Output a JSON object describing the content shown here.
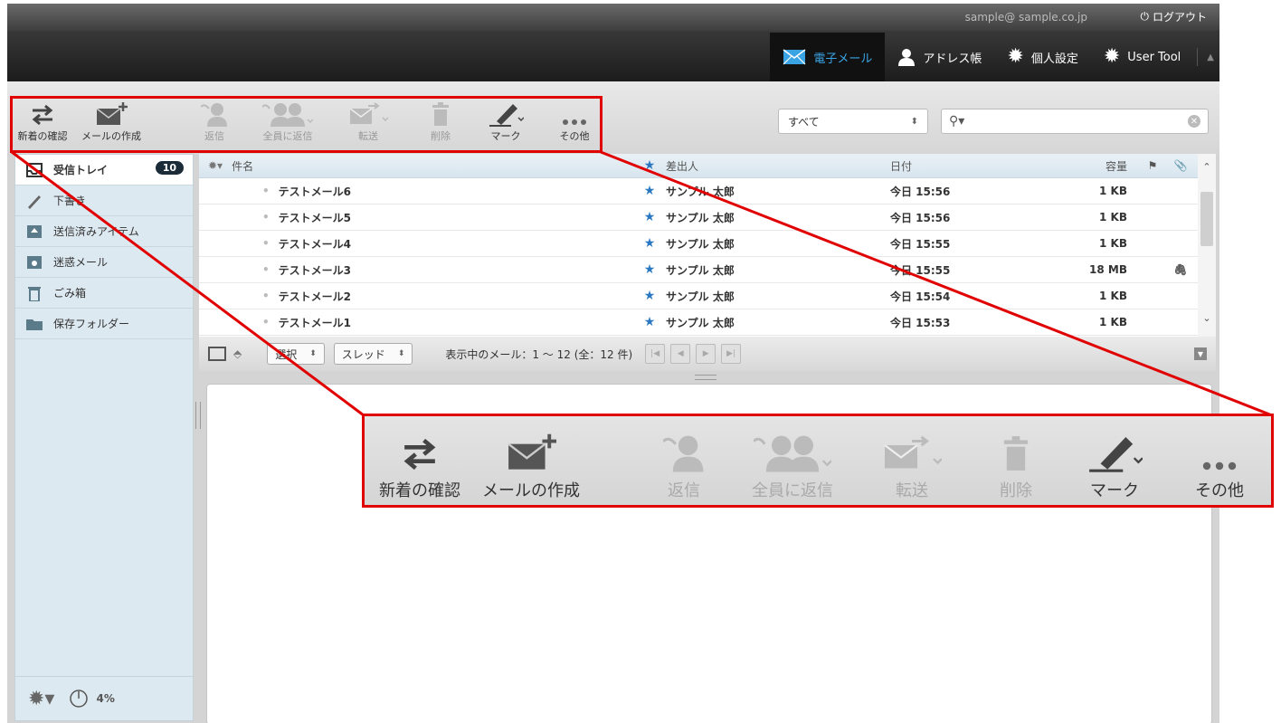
{
  "header": {
    "user_email": "sample@ sample.co.jp",
    "logout_label": "ログアウト",
    "nav": [
      {
        "label": "電子メール",
        "icon": "mail-icon",
        "active": true
      },
      {
        "label": "アドレス帳",
        "icon": "person-icon",
        "active": false
      },
      {
        "label": "個人設定",
        "icon": "gear-icon",
        "active": false
      },
      {
        "label": "User Tool",
        "icon": "user-tool-icon",
        "active": false
      }
    ]
  },
  "toolbar": {
    "buttons": [
      {
        "label": "新着の確認",
        "icon": "refresh-arrows-icon",
        "enabled": true
      },
      {
        "label": "メールの作成",
        "icon": "compose-mail-icon",
        "enabled": true
      },
      {
        "label": "返信",
        "icon": "reply-icon",
        "enabled": false
      },
      {
        "label": "全員に返信",
        "icon": "reply-all-icon",
        "enabled": false
      },
      {
        "label": "転送",
        "icon": "forward-icon",
        "enabled": false
      },
      {
        "label": "削除",
        "icon": "trash-icon",
        "enabled": false
      },
      {
        "label": "マーク",
        "icon": "mark-pen-icon",
        "enabled": true
      },
      {
        "label": "その他",
        "icon": "more-dots-icon",
        "enabled": true
      }
    ],
    "filter_value": "すべて",
    "search_placeholder": ""
  },
  "sidebar": {
    "folders": [
      {
        "label": "受信トレイ",
        "icon": "inbox-icon",
        "badge": "10",
        "active": true
      },
      {
        "label": "下書き",
        "icon": "pencil-icon",
        "badge": "",
        "active": false
      },
      {
        "label": "送信済みアイテム",
        "icon": "sent-icon",
        "badge": "",
        "active": false
      },
      {
        "label": "迷惑メール",
        "icon": "junk-icon",
        "badge": "",
        "active": false
      },
      {
        "label": "ごみ箱",
        "icon": "trash-icon",
        "badge": "",
        "active": false
      },
      {
        "label": "保存フォルダー",
        "icon": "folder-icon",
        "badge": "",
        "active": false
      }
    ],
    "quota": "4%"
  },
  "list": {
    "columns": {
      "subject": "件名",
      "from": "差出人",
      "date": "日付",
      "size": "容量"
    },
    "rows": [
      {
        "subject": "テストメール6",
        "from": "サンプル 太郎",
        "date": "今日 15:56",
        "size": "1 KB",
        "attachment": false
      },
      {
        "subject": "テストメール5",
        "from": "サンプル 太郎",
        "date": "今日 15:56",
        "size": "1 KB",
        "attachment": false
      },
      {
        "subject": "テストメール4",
        "from": "サンプル 太郎",
        "date": "今日 15:55",
        "size": "1 KB",
        "attachment": false
      },
      {
        "subject": "テストメール3",
        "from": "サンプル 太郎",
        "date": "今日 15:55",
        "size": "18 MB",
        "attachment": true
      },
      {
        "subject": "テストメール2",
        "from": "サンプル 太郎",
        "date": "今日 15:54",
        "size": "1 KB",
        "attachment": false
      },
      {
        "subject": "テストメール1",
        "from": "サンプル 太郎",
        "date": "今日 15:53",
        "size": "1 KB",
        "attachment": false
      }
    ]
  },
  "pager": {
    "select_label": "選択",
    "thread_label": "スレッド",
    "summary": "表示中のメール：1 〜 12 (全：12 件)"
  },
  "colors": {
    "accent": "#3aa3e3",
    "highlight": "#e00000",
    "star": "#2a78c2"
  }
}
